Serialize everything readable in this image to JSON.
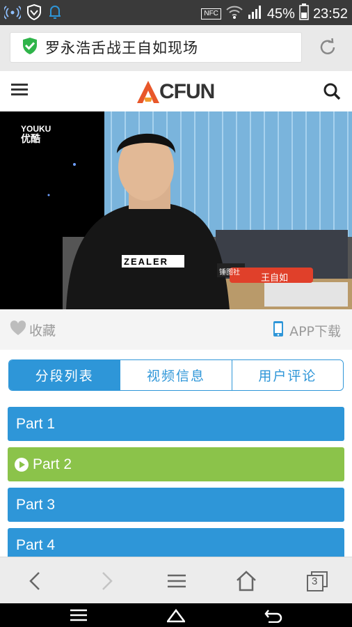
{
  "status": {
    "nfc": "NFC",
    "battery": "45%",
    "time": "23:52"
  },
  "browser": {
    "page_title": "罗永浩舌战王自如现场",
    "tab_count": "3"
  },
  "site": {
    "logo_letter": "A",
    "logo_text": "CFUN"
  },
  "video": {
    "watermark_top": "YOUKU",
    "watermark_bottom": "优酷",
    "shirt_text": "ZEALER",
    "caption": "王自如",
    "caption_tag": "锤图社"
  },
  "actions": {
    "favorite": "收藏",
    "app_download": "APP下载"
  },
  "tabs": [
    {
      "label": "分段列表",
      "active": true
    },
    {
      "label": "视频信息",
      "active": false
    },
    {
      "label": "用户评论",
      "active": false
    }
  ],
  "parts": [
    {
      "label": "Part 1",
      "active": false
    },
    {
      "label": "Part 2",
      "active": true
    },
    {
      "label": "Part 3",
      "active": false
    },
    {
      "label": "Part 4",
      "active": false
    }
  ],
  "colors": {
    "accent": "#2e96d8",
    "active_part": "#8bc34a",
    "logo_orange": "#e8572a"
  }
}
